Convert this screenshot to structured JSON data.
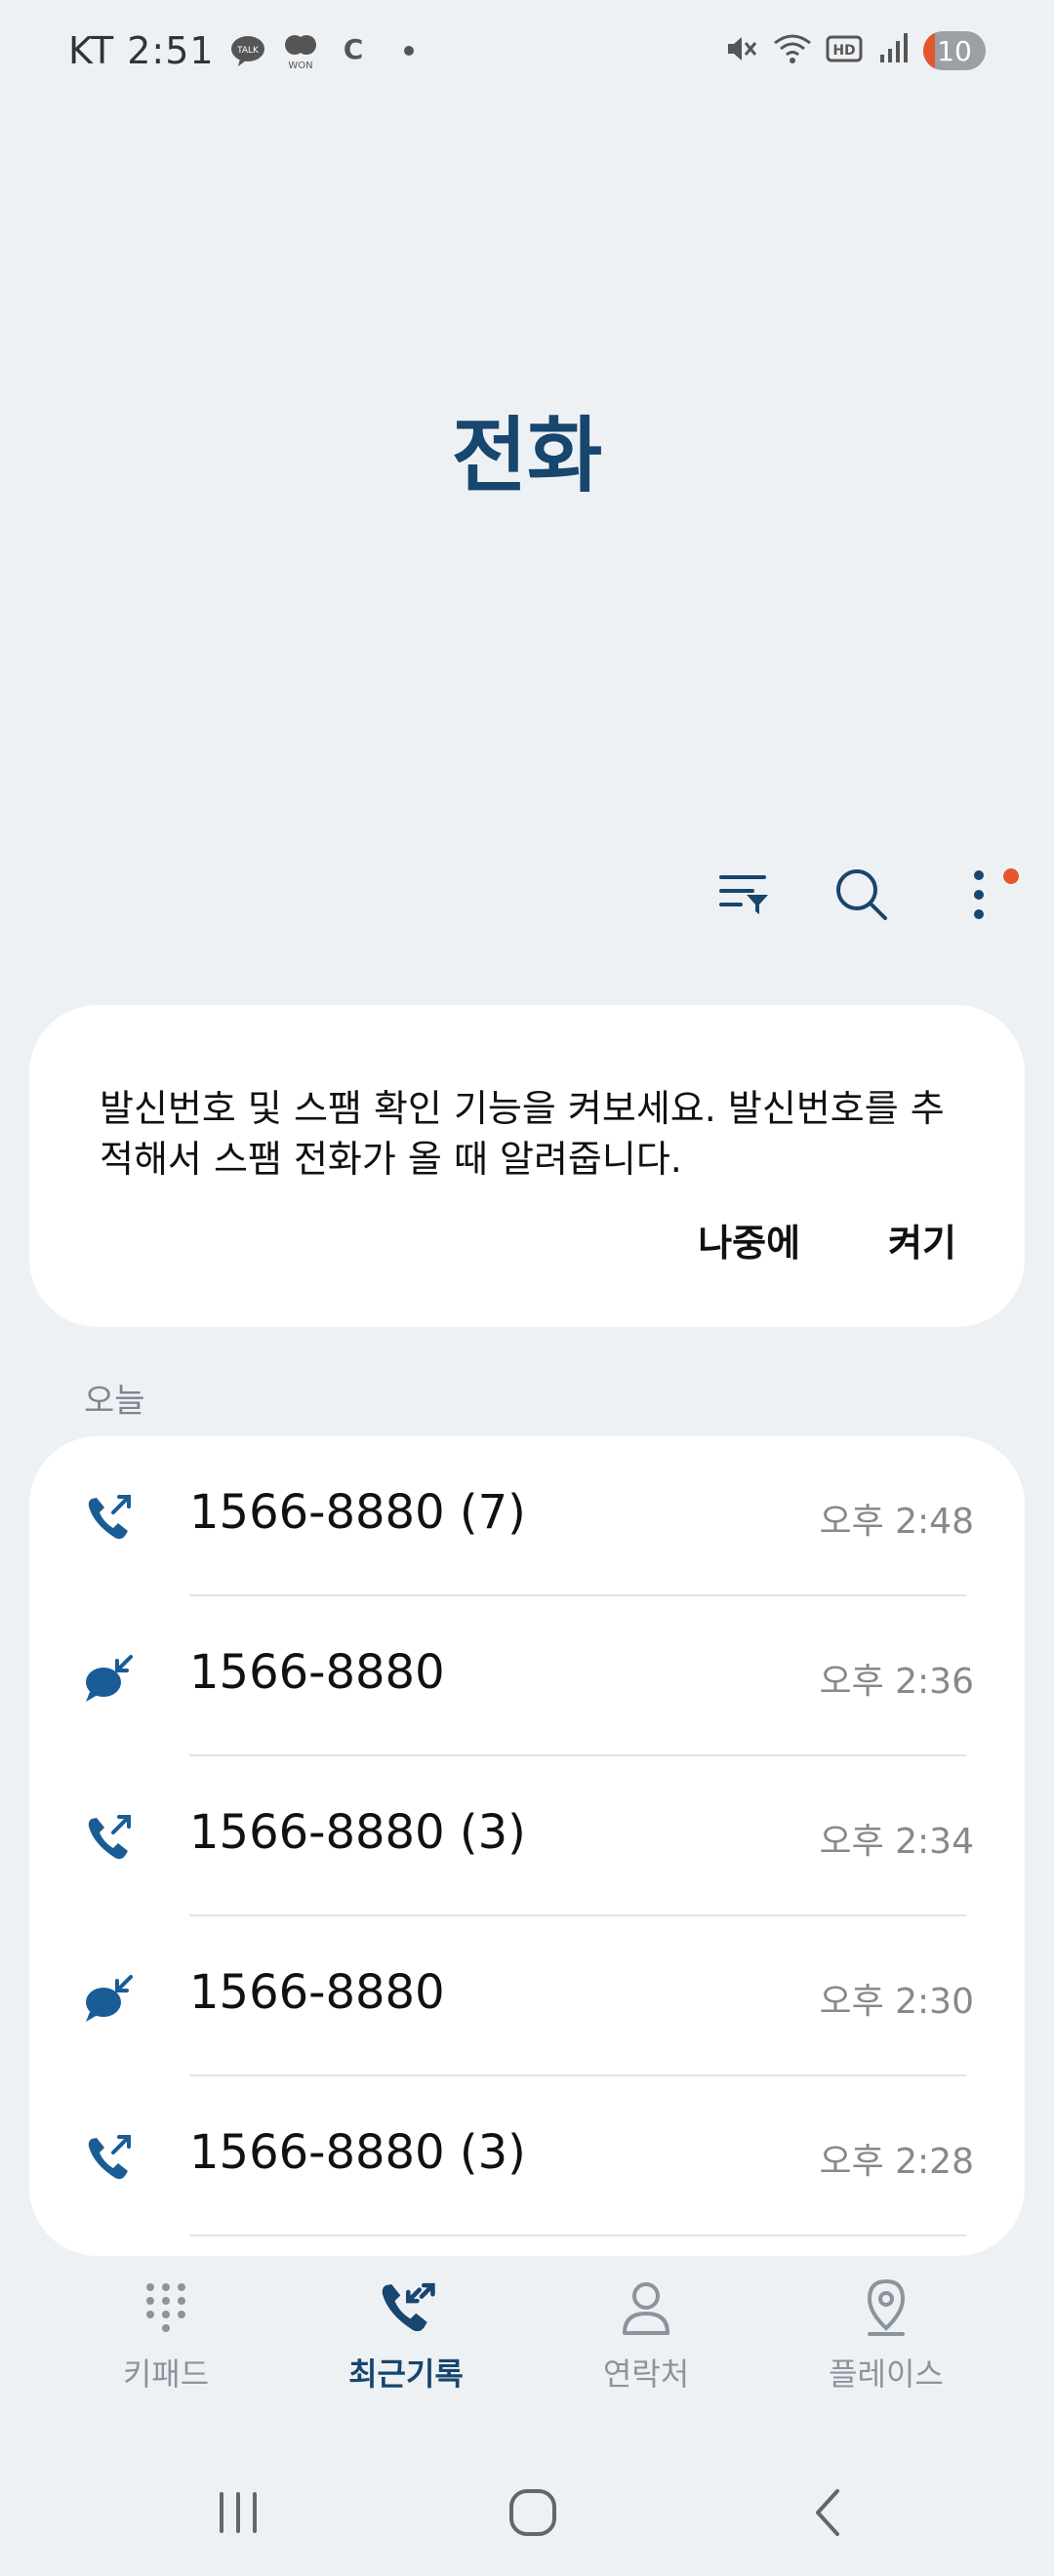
{
  "status": {
    "carrier_time": "KT 2:51",
    "apps": [
      "TALK",
      "WON",
      "C"
    ],
    "battery": "10",
    "hd": "HD"
  },
  "title": "전화",
  "toolbar": {
    "icons": [
      "filter-icon",
      "search-icon",
      "more-icon"
    ]
  },
  "notice": {
    "text": "발신번호 및 스팸 확인 기능을 켜보세요. 발신번호를 추적해서 스팸 전화가 올 때 알려줍니다.",
    "later_label": "나중에",
    "enable_label": "켜기"
  },
  "section_label": "오늘",
  "calls": [
    {
      "type": "outgoing",
      "number": "1566-8880 (7)",
      "time": "오후 2:48"
    },
    {
      "type": "message",
      "number": "1566-8880",
      "time": "오후 2:36"
    },
    {
      "type": "outgoing",
      "number": "1566-8880 (3)",
      "time": "오후 2:34"
    },
    {
      "type": "message",
      "number": "1566-8880",
      "time": "오후 2:30"
    },
    {
      "type": "outgoing",
      "number": "1566-8880 (3)",
      "time": "오후 2:28"
    }
  ],
  "nav": {
    "keypad": "키패드",
    "recents": "최근기록",
    "contacts": "연락처",
    "places": "플레이스"
  },
  "colors": {
    "accent": "#17466e",
    "icon_blue": "#1a5c96",
    "badge": "#e4572e",
    "background": "#eef1f4"
  }
}
